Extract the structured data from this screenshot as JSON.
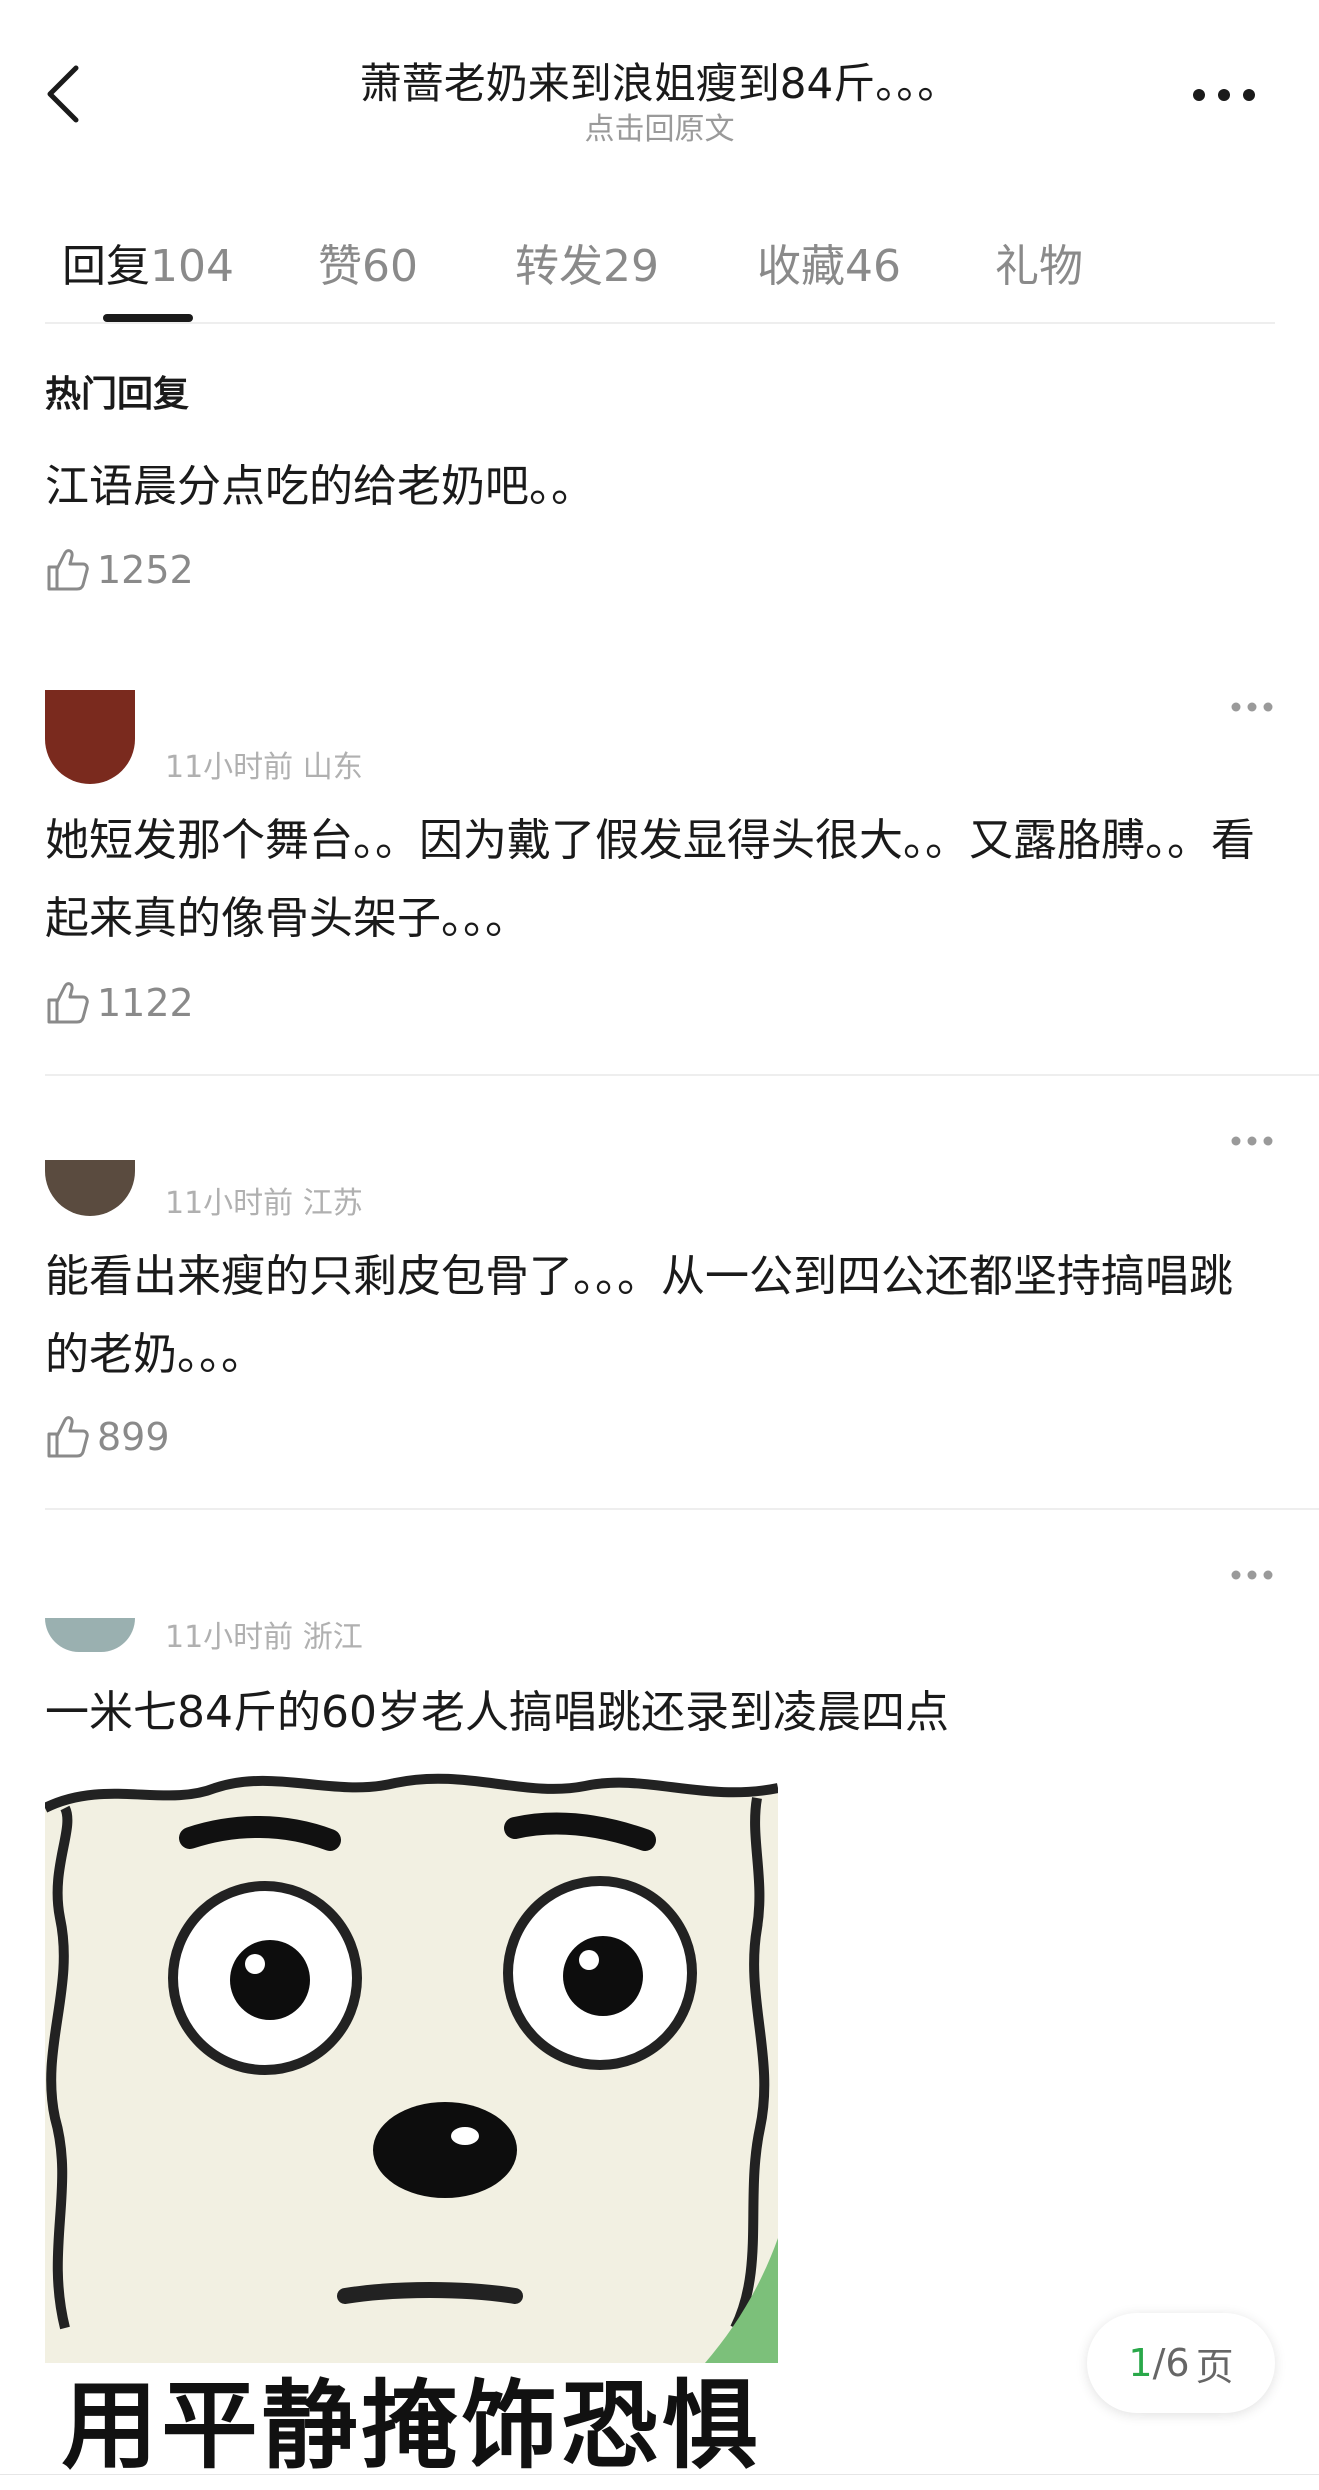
{
  "header": {
    "title": "萧蔷老奶来到浪姐瘦到84斤。。。",
    "subtitle": "点击回原文"
  },
  "tabs": [
    {
      "label": "回复",
      "count": "104"
    },
    {
      "label": "赞",
      "count": "60"
    },
    {
      "label": "转发",
      "count": "29"
    },
    {
      "label": "收藏",
      "count": "46"
    },
    {
      "label": "礼物",
      "count": ""
    }
  ],
  "section_title": "热门回复",
  "comments": [
    {
      "text": "江语晨分点吃的给老奶吧。。",
      "likes": "1252",
      "meta": ""
    },
    {
      "text": "她短发那个舞台。。因为戴了假发显得头很大。。又露胳膊。。看起来真的像骨头架子。。。",
      "likes": "1122",
      "meta": "11小时前 山东"
    },
    {
      "text": "能看出来瘦的只剩皮包骨了。。。从一公到四公还都坚持搞唱跳的老奶。。。",
      "likes": "899",
      "meta": "11小时前 江苏"
    },
    {
      "text": "一米七84斤的60岁老人搞唱跳还录到凌晨四点",
      "likes": "",
      "meta": "11小时前 浙江"
    }
  ],
  "sticker": {
    "caption": "用平静掩饰恐惧"
  },
  "pager": {
    "current": "1",
    "total": "/6",
    "unit": "页"
  },
  "colors": {
    "accent_green": "#2aa84a",
    "text": "#1a1a1a",
    "muted": "#8a8a8a"
  }
}
